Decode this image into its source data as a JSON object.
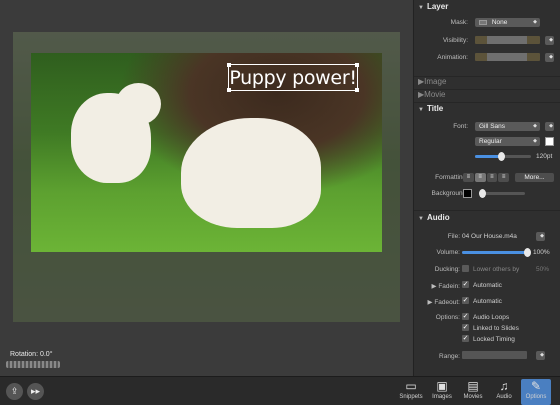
{
  "canvas": {
    "title_text": "Puppy power!",
    "rotation_label": "Rotation: 0.0°"
  },
  "inspector": {
    "layer": {
      "header": "Layer",
      "mask_label": "Mask:",
      "mask_value": "None",
      "visibility_label": "Visibility:",
      "animation_label": "Animation:"
    },
    "collapsed": [
      "Image",
      "Movie"
    ],
    "title": {
      "header": "Title",
      "font_label": "Font:",
      "font_value": "Gill Sans",
      "style_value": "Regular",
      "size_value": "120pt",
      "size_fraction": 0.48,
      "formatting_label": "Formatting:",
      "more_button": "More...",
      "background_label": "Background:",
      "text_color": "#ffffff",
      "background_color": "#000000"
    },
    "audio": {
      "header": "Audio",
      "file_label": "File:",
      "file_value": "04 Our House.m4a",
      "volume_label": "Volume:",
      "volume_value": "100%",
      "volume_fraction": 1.0,
      "ducking_label": "Ducking:",
      "ducking_text": "Lower others by",
      "ducking_value": "50%",
      "fadein_label": "Fadein:",
      "fadein_text": "Automatic",
      "fadeout_label": "Fadeout:",
      "fadeout_text": "Automatic",
      "options_label": "Options:",
      "options": [
        "Audio Loops",
        "Linked to Slides",
        "Locked Timing"
      ],
      "range_label": "Range:"
    }
  },
  "toolbar": {
    "share_icon": "share-icon",
    "play_icon": "fast-forward-icon",
    "tools": [
      {
        "label": "Snippets",
        "icon": "snippets-icon"
      },
      {
        "label": "Images",
        "icon": "images-icon"
      },
      {
        "label": "Movies",
        "icon": "movies-icon"
      },
      {
        "label": "Audio",
        "icon": "audio-icon"
      },
      {
        "label": "Options",
        "icon": "options-icon",
        "active": true
      }
    ],
    "accent": "#4a7fc1"
  }
}
